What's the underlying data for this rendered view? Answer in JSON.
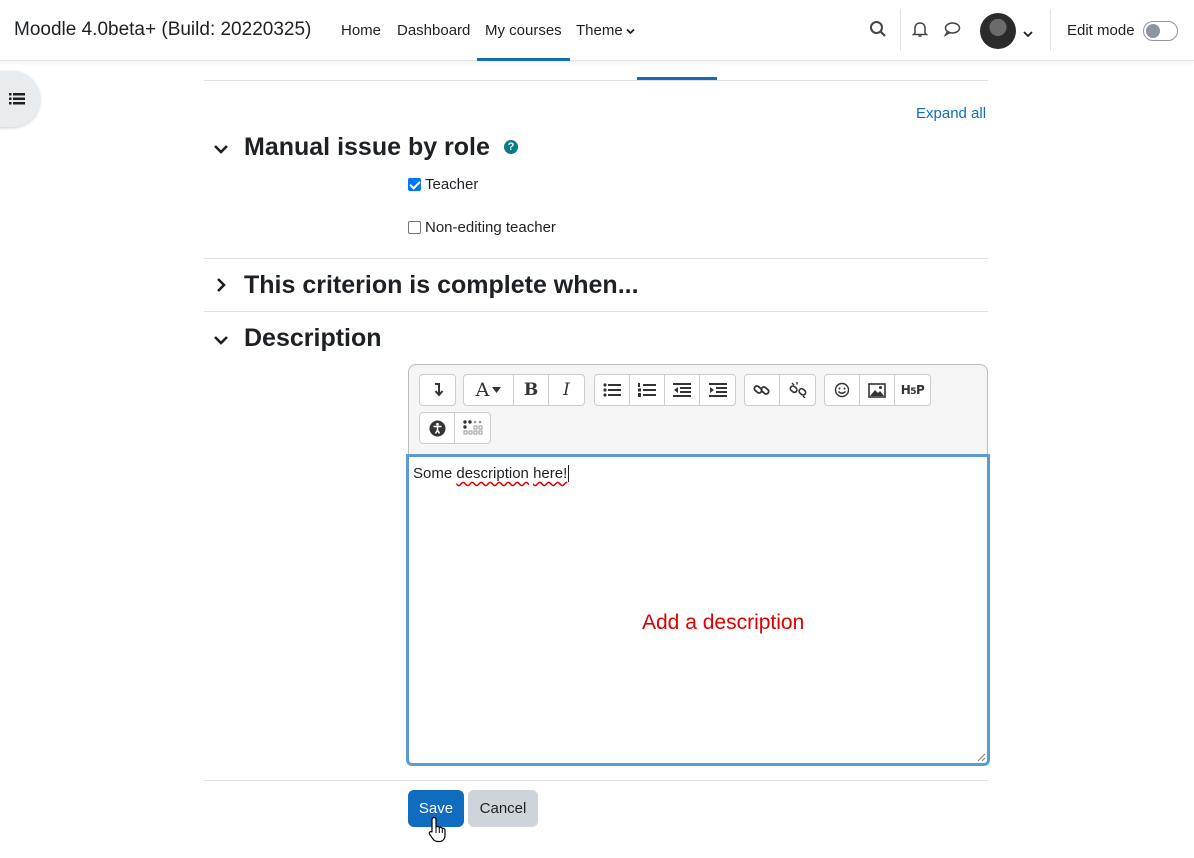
{
  "navbar": {
    "brand": "Moodle 4.0beta+ (Build: 20220325)",
    "links": [
      {
        "label": "Home"
      },
      {
        "label": "Dashboard"
      },
      {
        "label": "My courses",
        "active": true
      },
      {
        "label": "Theme"
      }
    ],
    "edit_mode_label": "Edit mode",
    "edit_mode_on": false
  },
  "page": {
    "expand_all": "Expand all",
    "sections": {
      "manual": {
        "title": "Manual issue by role",
        "expanded": true,
        "roles": [
          {
            "label": "Teacher",
            "checked": true
          },
          {
            "label": "Non-editing teacher",
            "checked": false
          }
        ]
      },
      "criterion": {
        "title": "This criterion is complete when...",
        "expanded": false
      },
      "description": {
        "title": "Description",
        "expanded": true
      }
    },
    "editor": {
      "content_words": [
        "Some",
        "description",
        "here!"
      ],
      "annotation": "Add a description"
    },
    "buttons": {
      "save": "Save",
      "cancel": "Cancel"
    }
  },
  "colors": {
    "accent": "#0f6cbf",
    "annotation": "#e00000",
    "editor_focus": "#5b9bd5"
  },
  "icons": [
    "search-icon",
    "bell-icon",
    "chat-icon",
    "chevron-down-icon",
    "list-icon",
    "help-icon",
    "pointer-cursor-icon"
  ]
}
